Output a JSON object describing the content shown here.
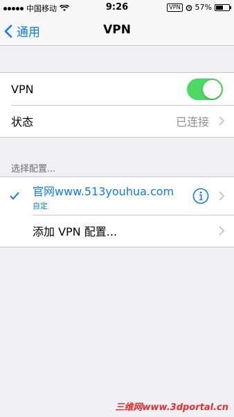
{
  "status_bar": {
    "carrier": "中国移动",
    "time": "9:26",
    "vpn_badge": "VPN",
    "battery": "57%",
    "battery_level": 0.57
  },
  "nav": {
    "back_label": "通用",
    "title": "VPN"
  },
  "vpn_group": {
    "vpn_label": "VPN",
    "vpn_enabled": true,
    "status_label": "状态",
    "status_value": "已连接"
  },
  "config_section": {
    "header": "选择配置...",
    "config_name": "官网www.513youhua.com",
    "config_sub": "自定",
    "add_label": "添加 VPN 配置..."
  },
  "watermark": "三维网www.3dportal.cn",
  "colors": {
    "accent": "#0a7aff",
    "toggle_on": "#4cd964",
    "background": "#efeff4"
  }
}
